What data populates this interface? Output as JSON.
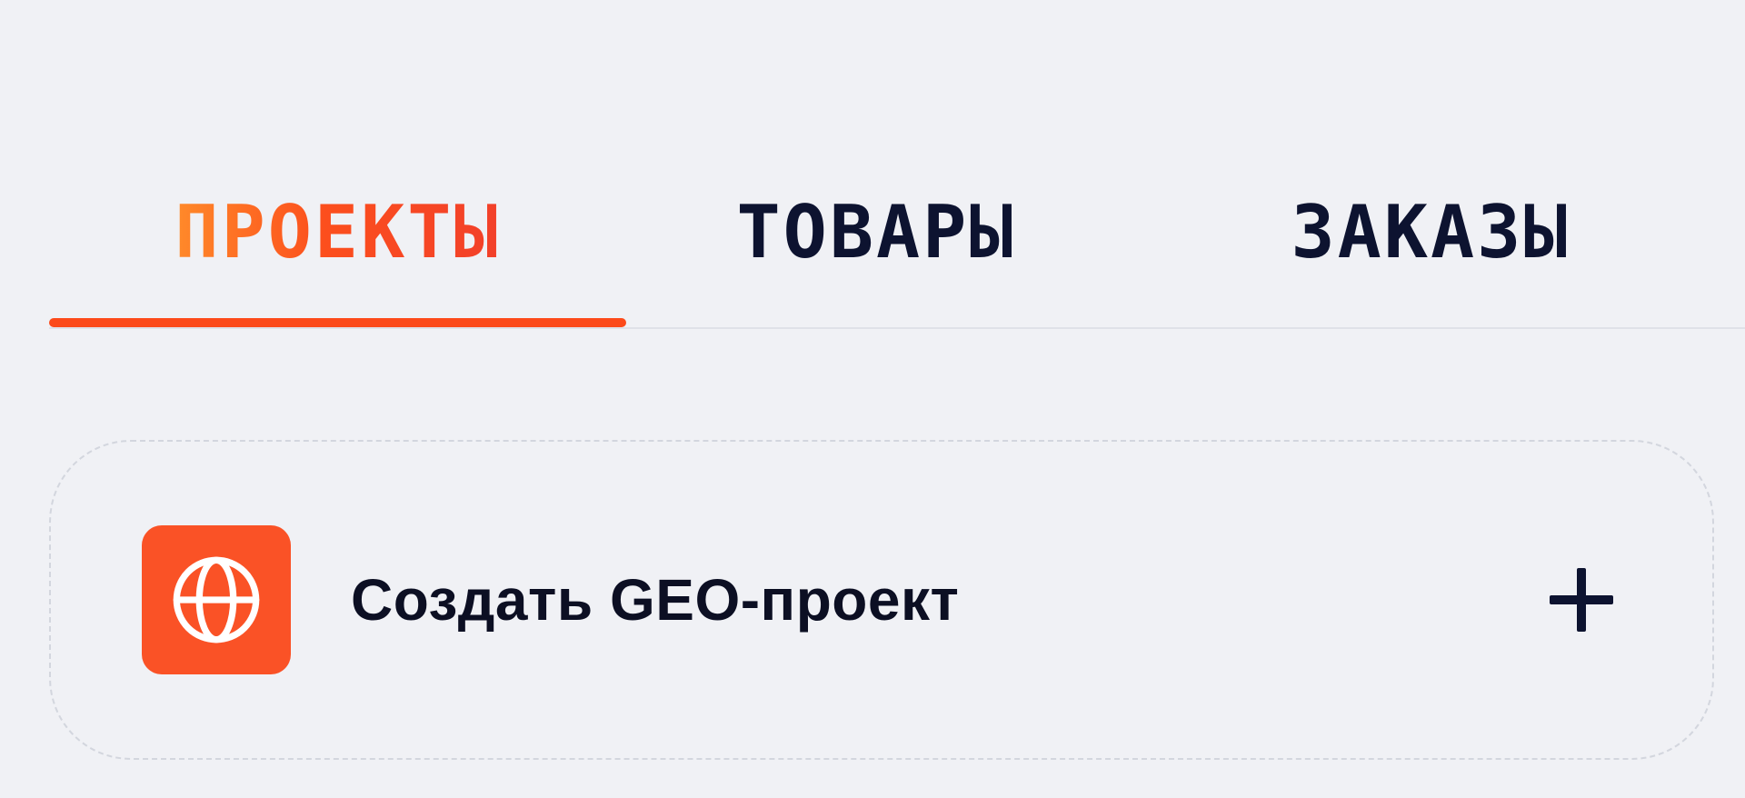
{
  "tabs": [
    {
      "label": "ПРОЕКТЫ",
      "active": true
    },
    {
      "label": "ТОВАРЫ",
      "active": false
    },
    {
      "label": "ЗАКАЗЫ",
      "active": false
    }
  ],
  "create_card": {
    "label": "Создать GEO-проект",
    "icon": "globe-icon",
    "action_icon": "plus-icon"
  },
  "colors": {
    "background": "#f0f1f5",
    "accent": "#fc4f1d",
    "text_dark": "#0d1330",
    "divider": "#dfe1e8",
    "card_border": "#d3d6de"
  }
}
